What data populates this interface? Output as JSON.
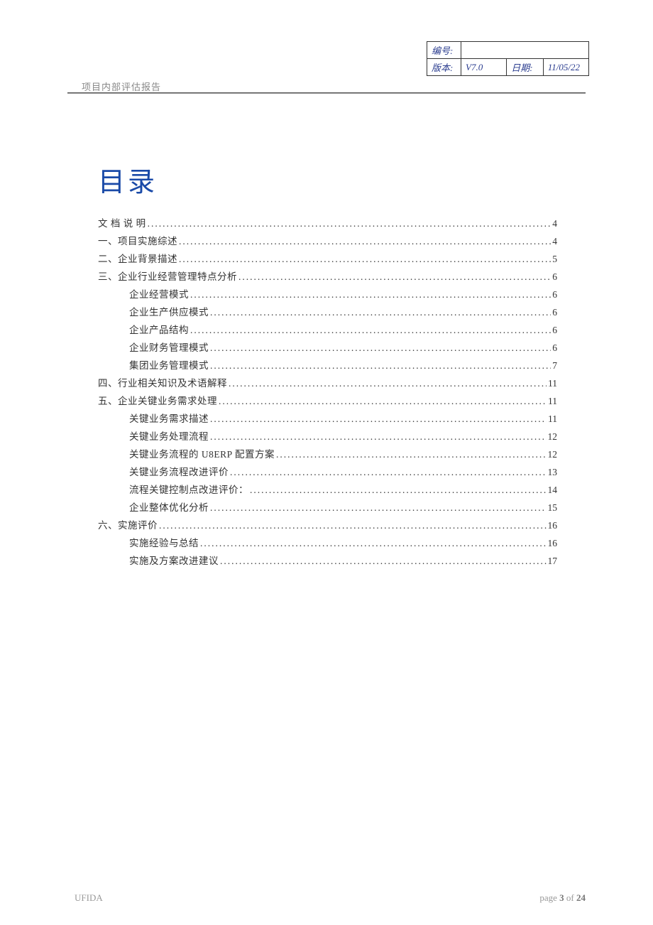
{
  "header": {
    "doc_label": "项目内部评估报告",
    "meta": {
      "number_label": "编号:",
      "number_value": "",
      "version_label": "版本:",
      "version_value": "V7.0",
      "date_label": "日期:",
      "date_value": "11/05/22"
    }
  },
  "toc": {
    "title": "目录",
    "entries": [
      {
        "level": "top",
        "label": "文 档 说 明",
        "page": "4",
        "spaced": false
      },
      {
        "level": "top",
        "label": "一、项目实施综述",
        "page": "4"
      },
      {
        "level": "top",
        "label": "二、企业背景描述",
        "page": "5"
      },
      {
        "level": "top",
        "label": "三、企业行业经营管理特点分析",
        "page": "6"
      },
      {
        "level": "sub",
        "label": "企业经营模式",
        "page": "6"
      },
      {
        "level": "sub",
        "label": "企业生产供应模式",
        "page": "6"
      },
      {
        "level": "sub",
        "label": "企业产品结构",
        "page": "6"
      },
      {
        "level": "sub",
        "label": "企业财务管理模式",
        "page": "6"
      },
      {
        "level": "sub",
        "label": "集团业务管理模式",
        "page": "7"
      },
      {
        "level": "top",
        "label": "四、行业相关知识及术语解释",
        "page": "11"
      },
      {
        "level": "top",
        "label": "五、企业关键业务需求处理",
        "page": "11"
      },
      {
        "level": "sub",
        "label": "关键业务需求描述",
        "page": "11"
      },
      {
        "level": "sub",
        "label": "关键业务处理流程",
        "page": "12"
      },
      {
        "level": "sub",
        "label": "关键业务流程的 U8ERP 配置方案",
        "page": "12"
      },
      {
        "level": "sub",
        "label": "关键业务流程改进评价",
        "page": "13"
      },
      {
        "level": "sub",
        "label": "流程关键控制点改进评价：",
        "page": "14"
      },
      {
        "level": "sub",
        "label": "企业整体优化分析",
        "page": "15"
      },
      {
        "level": "top",
        "label": "六、实施评价",
        "page": "16"
      },
      {
        "level": "sub",
        "label": "实施经验与总结",
        "page": "16"
      },
      {
        "level": "sub",
        "label": "实施及方案改进建议",
        "page": "17"
      }
    ]
  },
  "footer": {
    "left": "UFIDA",
    "page_prefix": "page ",
    "page_current": "3",
    "page_sep": " of ",
    "page_total": "24"
  }
}
